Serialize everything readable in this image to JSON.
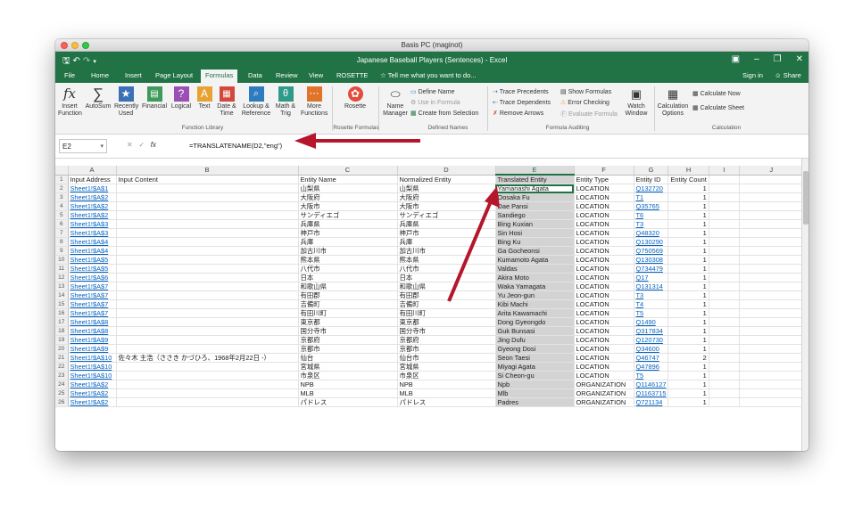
{
  "window": {
    "mac_title": "Basis PC (maginot)",
    "doc_title": "Japanese Baseball Players (Sentences) - Excel"
  },
  "colors": {
    "excel_green": "#217346",
    "arrow": "#b5162b",
    "link": "#0563c1"
  },
  "tabs": [
    "File",
    "Home",
    "Insert",
    "Page Layout",
    "Formulas",
    "Data",
    "Review",
    "View",
    "ROSETTE"
  ],
  "tell_me": "Tell me what you want to do...",
  "account": {
    "sign_in": "Sign in",
    "share": "Share"
  },
  "ribbon": {
    "insert_function": "Insert Function",
    "autosum": "AutoSum",
    "recently_used": "Recently Used",
    "financial": "Financial",
    "logical": "Logical",
    "text": "Text",
    "date_time": "Date & Time",
    "lookup_reference": "Lookup & Reference",
    "math_trig": "Math & Trig",
    "more_functions": "More Functions",
    "rosette": "Rosette",
    "name_manager": "Name Manager",
    "define_name": "Define Name",
    "use_in_formula": "Use in Formula",
    "create_from_selection": "Create from Selection",
    "trace_precedents": "Trace Precedents",
    "trace_dependents": "Trace Dependents",
    "remove_arrows": "Remove Arrows",
    "show_formulas": "Show Formulas",
    "error_checking": "Error Checking",
    "evaluate_formula": "Evaluate Formula",
    "watch_window": "Watch Window",
    "calculation_options": "Calculation Options",
    "calculate_now": "Calculate Now",
    "calculate_sheet": "Calculate Sheet",
    "groups": [
      "Function Library",
      "Rosette Formulas",
      "Defined Names",
      "Formula Auditing",
      "Calculation"
    ]
  },
  "formula_bar": {
    "name_box": "E2",
    "formula": "=TRANSLATENAME(D2,\"eng\")"
  },
  "sheet": {
    "columns": [
      "A",
      "B",
      "C",
      "D",
      "E",
      "F",
      "G",
      "H",
      "I",
      "J"
    ],
    "headers": [
      "Input Address",
      "Input Content",
      "Entity Name",
      "Normalized Entity",
      "Translated Entity",
      "Entity Type",
      "Entity ID",
      "Entity Count",
      "",
      ""
    ],
    "rows": [
      [
        "Sheet1!$A$1",
        "",
        "山梨県",
        "山梨県",
        "Yamanashi Agata",
        "LOCATION",
        "Q132720",
        "1"
      ],
      [
        "Sheet1!$A$2",
        "",
        "大阪府",
        "大阪府",
        "Oosaka Fu",
        "LOCATION",
        "T1",
        "1"
      ],
      [
        "Sheet1!$A$2",
        "",
        "大阪市",
        "大阪市",
        "Dae Pansi",
        "LOCATION",
        "Q35765",
        "1"
      ],
      [
        "Sheet1!$A$2",
        "",
        "サンディエゴ",
        "サンディエゴ",
        "Sandiego",
        "LOCATION",
        "T6",
        "1"
      ],
      [
        "Sheet1!$A$3",
        "",
        "兵庫県",
        "兵庫県",
        "Bing Kuxian",
        "LOCATION",
        "T3",
        "1"
      ],
      [
        "Sheet1!$A$3",
        "",
        "神戸市",
        "神戸市",
        "Sin Hosi",
        "LOCATION",
        "Q48320",
        "1"
      ],
      [
        "Sheet1!$A$4",
        "",
        "兵庫",
        "兵庫",
        "Bing Ku",
        "LOCATION",
        "Q130290",
        "1"
      ],
      [
        "Sheet1!$A$4",
        "",
        "加古川市",
        "加古川市",
        "Ga Gocheonsi",
        "LOCATION",
        "Q750569",
        "1"
      ],
      [
        "Sheet1!$A$5",
        "",
        "熊本県",
        "熊本県",
        "Kumamoto Agata",
        "LOCATION",
        "Q130308",
        "1"
      ],
      [
        "Sheet1!$A$5",
        "",
        "八代市",
        "八代市",
        "Valdas",
        "LOCATION",
        "Q734479",
        "1"
      ],
      [
        "Sheet1!$A$6",
        "",
        "日本",
        "日本",
        "Akira Moto",
        "LOCATION",
        "Q17",
        "1"
      ],
      [
        "Sheet1!$A$7",
        "",
        "和歌山県",
        "和歌山県",
        "Waka Yamagata",
        "LOCATION",
        "Q131314",
        "1"
      ],
      [
        "Sheet1!$A$7",
        "",
        "有田郡",
        "有田郡",
        "Yu Jeon-gun",
        "LOCATION",
        "T3",
        "1"
      ],
      [
        "Sheet1!$A$7",
        "",
        "吉備町",
        "吉備町",
        "Kibi Machi",
        "LOCATION",
        "T4",
        "1"
      ],
      [
        "Sheet1!$A$7",
        "",
        "有田川町",
        "有田川町",
        "Arita Kawamachi",
        "LOCATION",
        "T5",
        "1"
      ],
      [
        "Sheet1!$A$8",
        "",
        "東京都",
        "東京都",
        "Dong Gyeongdo",
        "LOCATION",
        "Q1490",
        "1"
      ],
      [
        "Sheet1!$A$8",
        "",
        "国分寺市",
        "国分寺市",
        "Guk Bunsasi",
        "LOCATION",
        "Q317834",
        "1"
      ],
      [
        "Sheet1!$A$9",
        "",
        "京都府",
        "京都府",
        "Jing Dufu",
        "LOCATION",
        "Q120730",
        "1"
      ],
      [
        "Sheet1!$A$9",
        "",
        "京都市",
        "京都市",
        "Gyeong Dosi",
        "LOCATION",
        "Q34600",
        "1"
      ],
      [
        "Sheet1!$A$10",
        "佐々木 主浩（ささき かづひろ、1968年2月22日 -）",
        "仙台",
        "仙台市",
        "Seon Taesi",
        "LOCATION",
        "Q46747",
        "2"
      ],
      [
        "Sheet1!$A$10",
        "",
        "宮城県",
        "宮城県",
        "Miyagi Agata",
        "LOCATION",
        "Q47896",
        "1"
      ],
      [
        "Sheet1!$A$10",
        "",
        "市泉区",
        "市泉区",
        "Si Cheon-gu",
        "LOCATION",
        "T5",
        "1"
      ],
      [
        "Sheet1!$A$2",
        "",
        "NPB",
        "NPB",
        "Npb",
        "ORGANIZATION",
        "Q1146127",
        "1"
      ],
      [
        "Sheet1!$A$2",
        "",
        "MLB",
        "MLB",
        "Mlb",
        "ORGANIZATION",
        "Q1163715",
        "1"
      ],
      [
        "Sheet1!$A$2",
        "",
        "パドレス",
        "パドレス",
        "Padres",
        "ORGANIZATION",
        "Q721134",
        "1"
      ]
    ]
  }
}
